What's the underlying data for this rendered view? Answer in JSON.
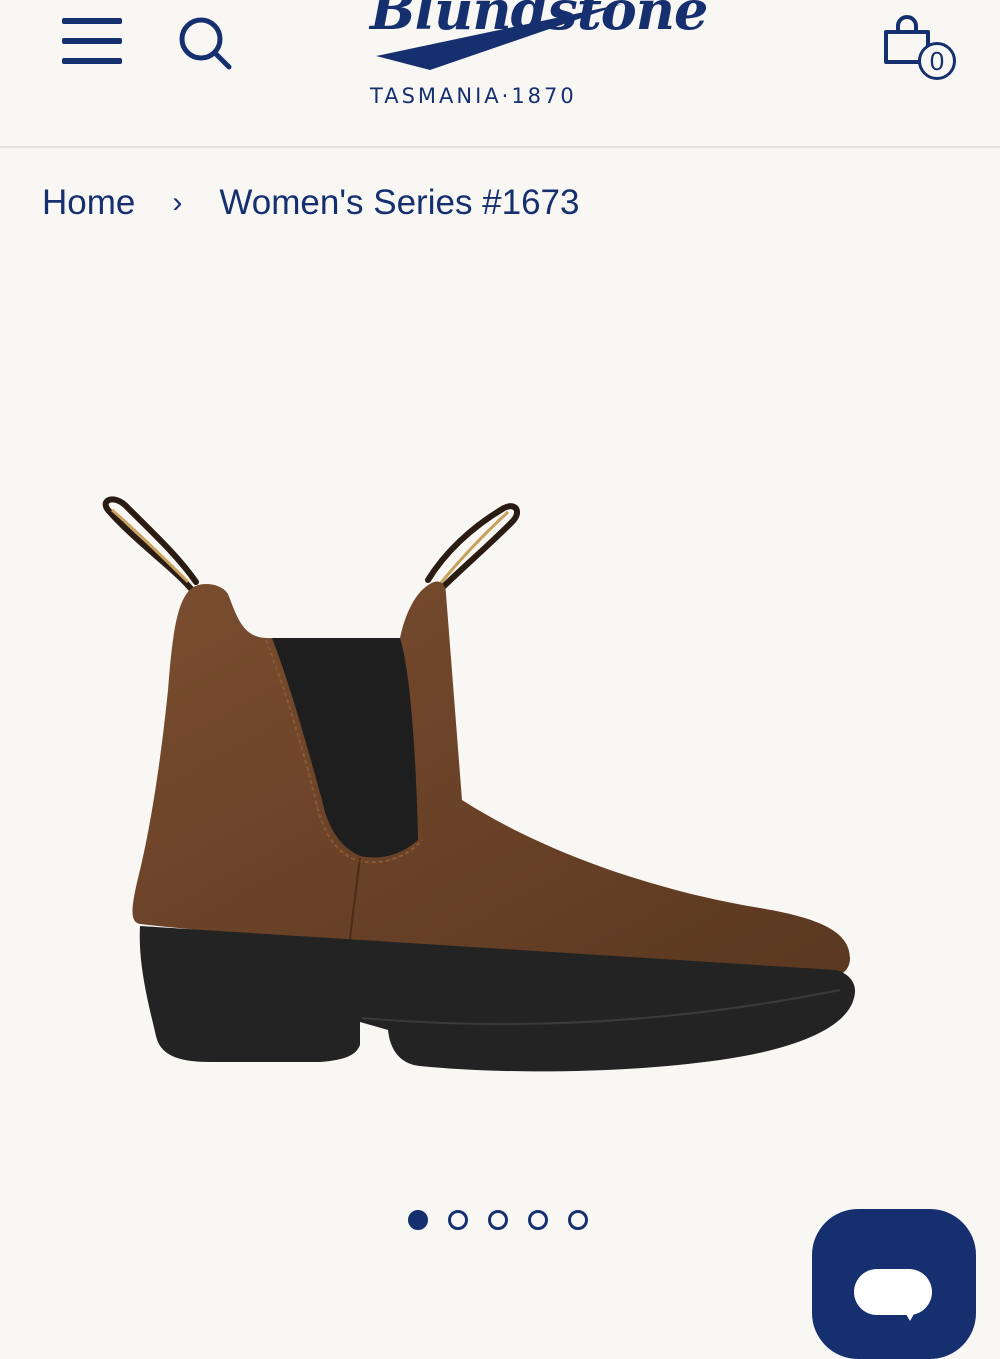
{
  "header": {
    "menu_icon": "hamburger-menu-icon",
    "search_icon": "search-icon",
    "logo": {
      "wordmark": "Blundstone",
      "tagline": "TASMANIA·1870"
    },
    "cart_icon": "shopping-bag-icon",
    "cart_count": "0"
  },
  "breadcrumb": {
    "items": [
      {
        "label": "Home"
      },
      {
        "label": "Women's Series #1673"
      }
    ],
    "separator_icon": "chevron-right-icon",
    "separator": "›"
  },
  "gallery": {
    "image_icon": "chelsea-boot-product-image",
    "slide_count": 5,
    "active_slide": 1
  },
  "chat": {
    "icon": "chat-bubble-icon"
  },
  "colors": {
    "brand_navy": "#16306f",
    "background": "#f8f7f4",
    "leather_brown": "#6e4529",
    "sole_black": "#222222"
  }
}
